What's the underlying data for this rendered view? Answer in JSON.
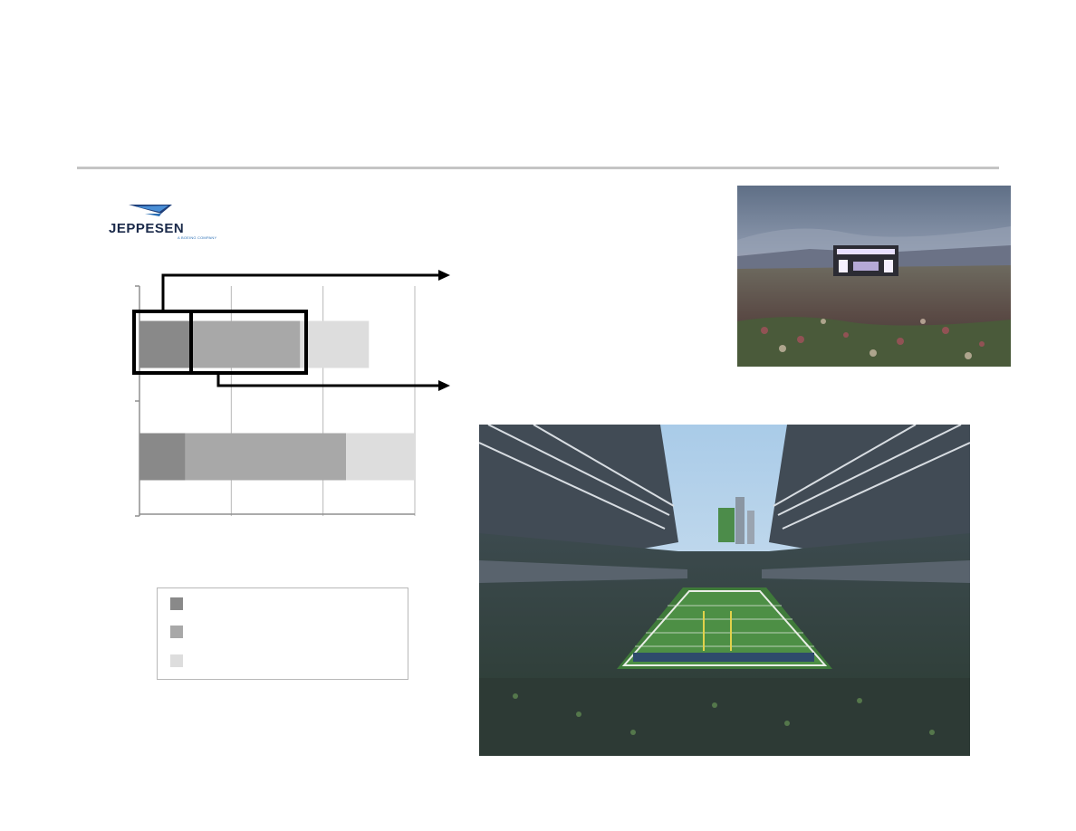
{
  "logo": {
    "text": "JEPPESEN",
    "subtext": "A BOEING COMPANY"
  },
  "chart_data": {
    "type": "bar",
    "orientation": "horizontal",
    "stacked": true,
    "categories": [
      "",
      ""
    ],
    "series": [
      {
        "values": [
          0.55,
          0.5
        ],
        "color": "#898989"
      },
      {
        "values": [
          1.2,
          1.75
        ],
        "color": "#a8a8a8"
      },
      {
        "values": [
          0.75,
          0.75
        ],
        "color": "#dddddd"
      }
    ],
    "xlim": [
      0,
      3
    ],
    "grid": true,
    "legend": "bottom"
  },
  "legend": {
    "labels": [
      "",
      "",
      ""
    ]
  },
  "photos": {
    "concert": {
      "name": "concert-photo"
    },
    "stadium": {
      "name": "stadium-photo"
    }
  }
}
